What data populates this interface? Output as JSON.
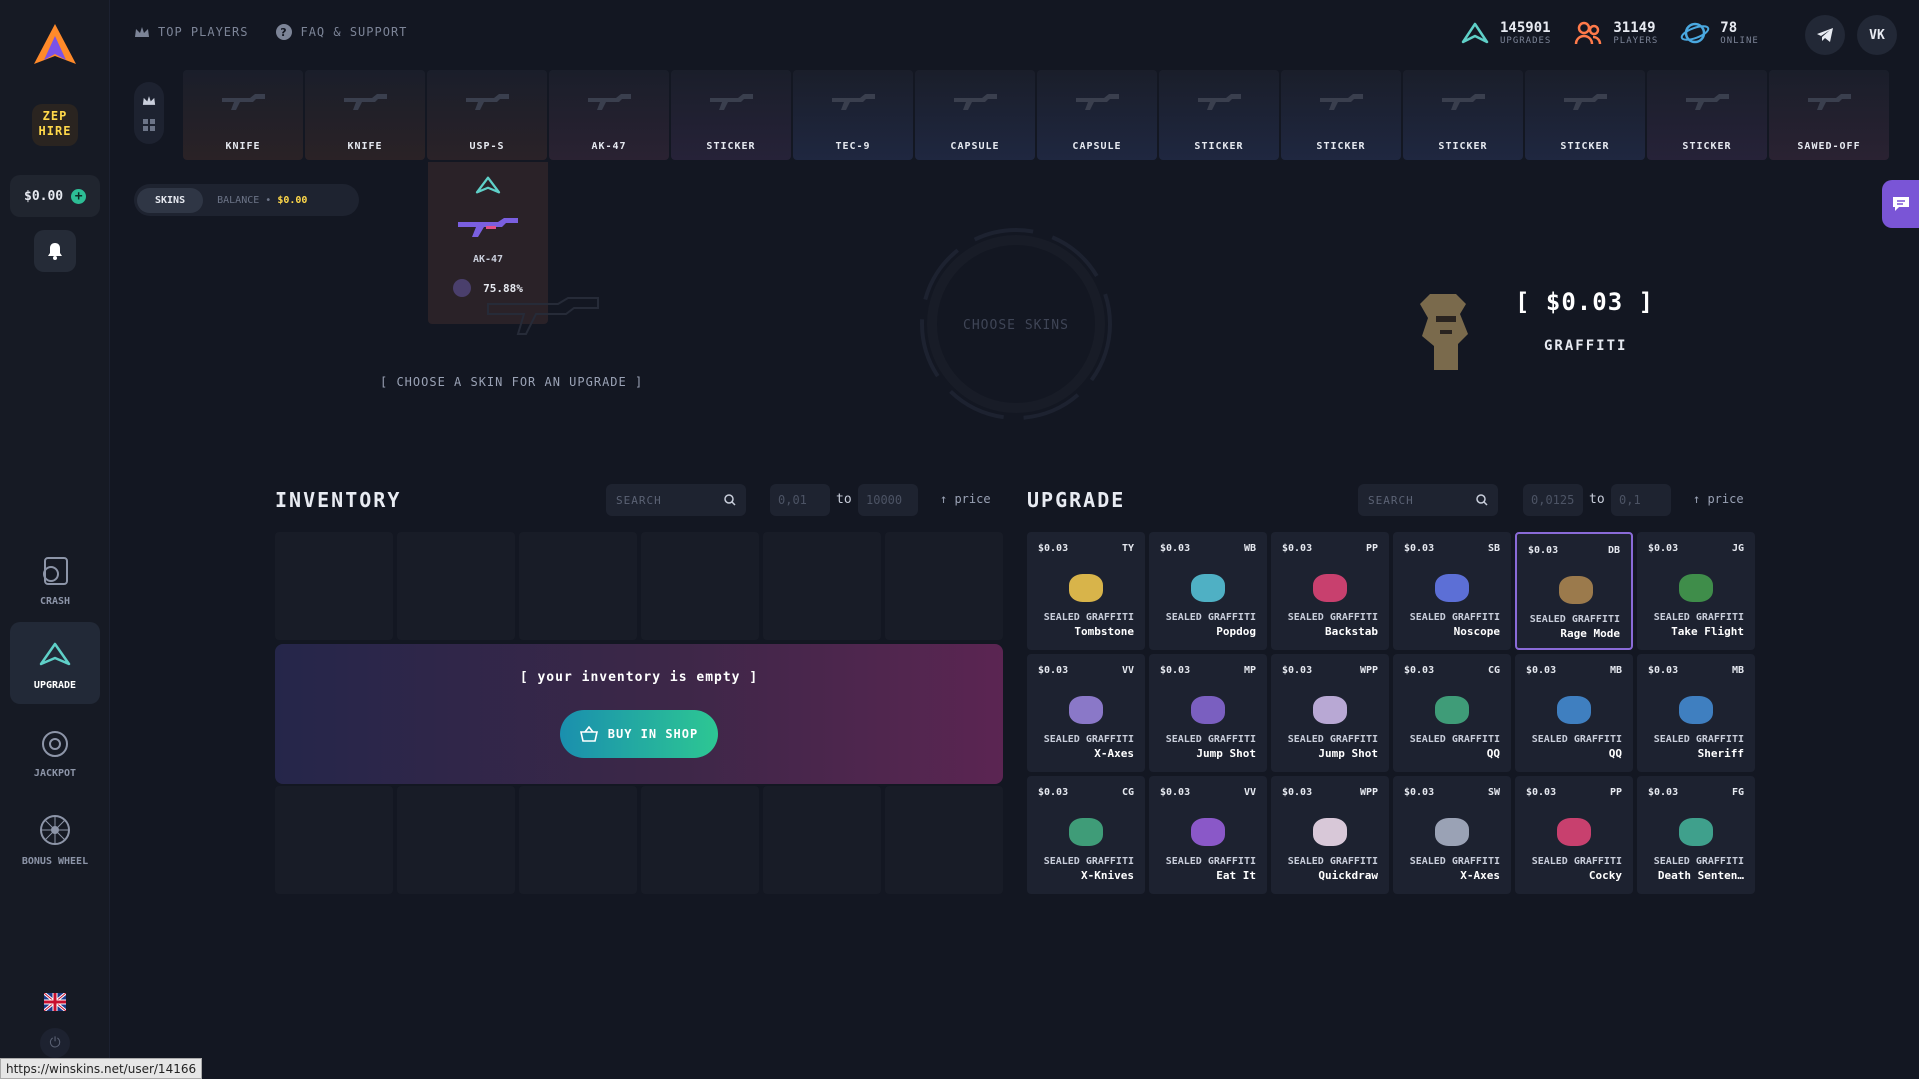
{
  "topnav": {
    "top_players": "TOP PLAYERS",
    "faq": "FAQ & SUPPORT"
  },
  "stats": [
    {
      "value": "145901",
      "label": "UPGRADES"
    },
    {
      "value": "31149",
      "label": "PLAYERS"
    },
    {
      "value": "78",
      "label": "ONLINE"
    }
  ],
  "social": {
    "vk": "VK"
  },
  "sidebar": {
    "zep_logo": "ZEP HIRE",
    "balance": "$0.00",
    "games": [
      {
        "label": "CRASH",
        "icon": "crash-icon"
      },
      {
        "label": "UPGRADE",
        "icon": "upgrade-icon"
      },
      {
        "label": "JACKPOT",
        "icon": "jackpot-icon"
      },
      {
        "label": "BONUS WHEEL",
        "icon": "bonus-wheel-icon"
      }
    ]
  },
  "live_drops": [
    {
      "name": "KNIFE",
      "bg": "#2a2226"
    },
    {
      "name": "KNIFE",
      "bg": "#2a2226"
    },
    {
      "name": "USP-S",
      "bg": "#2a2228"
    },
    {
      "name": "AK-47",
      "bg": "#2a2232"
    },
    {
      "name": "STICKER",
      "bg": "#262238"
    },
    {
      "name": "TEC-9",
      "bg": "#1f2740"
    },
    {
      "name": "CAPSULE",
      "bg": "#1f2740"
    },
    {
      "name": "CAPSULE",
      "bg": "#1f2740"
    },
    {
      "name": "STICKER",
      "bg": "#1f2740"
    },
    {
      "name": "STICKER",
      "bg": "#1f2740"
    },
    {
      "name": "STICKER",
      "bg": "#1f2740"
    },
    {
      "name": "STICKER",
      "bg": "#1f2740"
    },
    {
      "name": "STICKER",
      "bg": "#262238"
    },
    {
      "name": "SAWED-OFF",
      "bg": "#2a2232"
    }
  ],
  "hover_drop": {
    "name": "AK-47",
    "chance": "75.88%"
  },
  "tabs": {
    "skins": "SKINS",
    "balance_label": "BALANCE •",
    "balance_value": "$0.00"
  },
  "upgrade_area": {
    "choose_skins": "CHOOSE SKINS",
    "choose_upgrade": "[ CHOOSE A SKIN FOR AN UPGRADE ]",
    "target_price": "[  $0.03  ]",
    "target_name": "GRAFFITI"
  },
  "inventory": {
    "title": "INVENTORY",
    "search_placeholder": "SEARCH",
    "min": "0,01",
    "to": "to",
    "max": "10000",
    "sort": "price",
    "empty": "[ your inventory is empty ]",
    "buy_button": "BUY IN SHOP"
  },
  "upgrade": {
    "title": "UPGRADE",
    "search_placeholder": "SEARCH",
    "min": "0,0125",
    "to": "to",
    "max": "0,1",
    "sort": "price",
    "items": [
      {
        "price": "$0.03",
        "code": "TY",
        "type": "SEALED GRAFFITI",
        "name": "Tombstone",
        "color": "#d8b44a"
      },
      {
        "price": "$0.03",
        "code": "WB",
        "type": "SEALED GRAFFITI",
        "name": "Popdog",
        "color": "#4fb0c4"
      },
      {
        "price": "$0.03",
        "code": "PP",
        "type": "SEALED GRAFFITI",
        "name": "Backstab",
        "color": "#c8406e"
      },
      {
        "price": "$0.03",
        "code": "SB",
        "type": "SEALED GRAFFITI",
        "name": "Noscope",
        "color": "#5c6fd6"
      },
      {
        "price": "$0.03",
        "code": "DB",
        "type": "SEALED GRAFFITI",
        "name": "Rage Mode",
        "color": "#9b7a4c"
      },
      {
        "price": "$0.03",
        "code": "JG",
        "type": "SEALED GRAFFITI",
        "name": "Take Flight",
        "color": "#3f8d4a"
      },
      {
        "price": "$0.03",
        "code": "VV",
        "type": "SEALED GRAFFITI",
        "name": "X-Axes",
        "color": "#8a78c8"
      },
      {
        "price": "$0.03",
        "code": "MP",
        "type": "SEALED GRAFFITI",
        "name": "Jump Shot",
        "color": "#7a5fc0"
      },
      {
        "price": "$0.03",
        "code": "WPP",
        "type": "SEALED GRAFFITI",
        "name": "Jump Shot",
        "color": "#b8a8d4"
      },
      {
        "price": "$0.03",
        "code": "CG",
        "type": "SEALED GRAFFITI",
        "name": "QQ",
        "color": "#3f9c78"
      },
      {
        "price": "$0.03",
        "code": "MB",
        "type": "SEALED GRAFFITI",
        "name": "QQ",
        "color": "#3f7fc0"
      },
      {
        "price": "$0.03",
        "code": "MB",
        "type": "SEALED GRAFFITI",
        "name": "Sheriff",
        "color": "#3f7fc0"
      },
      {
        "price": "$0.03",
        "code": "CG",
        "type": "SEALED GRAFFITI",
        "name": "X-Knives",
        "color": "#3f9c78"
      },
      {
        "price": "$0.03",
        "code": "VV",
        "type": "SEALED GRAFFITI",
        "name": "Eat It",
        "color": "#8a58c8"
      },
      {
        "price": "$0.03",
        "code": "WPP",
        "type": "SEALED GRAFFITI",
        "name": "Quickdraw",
        "color": "#d8c8d8"
      },
      {
        "price": "$0.03",
        "code": "SW",
        "type": "SEALED GRAFFITI",
        "name": "X-Axes",
        "color": "#9aa2b5"
      },
      {
        "price": "$0.03",
        "code": "PP",
        "type": "SEALED GRAFFITI",
        "name": "Cocky",
        "color": "#c8406e"
      },
      {
        "price": "$0.03",
        "code": "FG",
        "type": "SEALED GRAFFITI",
        "name": "Death Senten…",
        "color": "#3fa08c"
      }
    ]
  },
  "status_url": "https://winskins.net/user/14166"
}
